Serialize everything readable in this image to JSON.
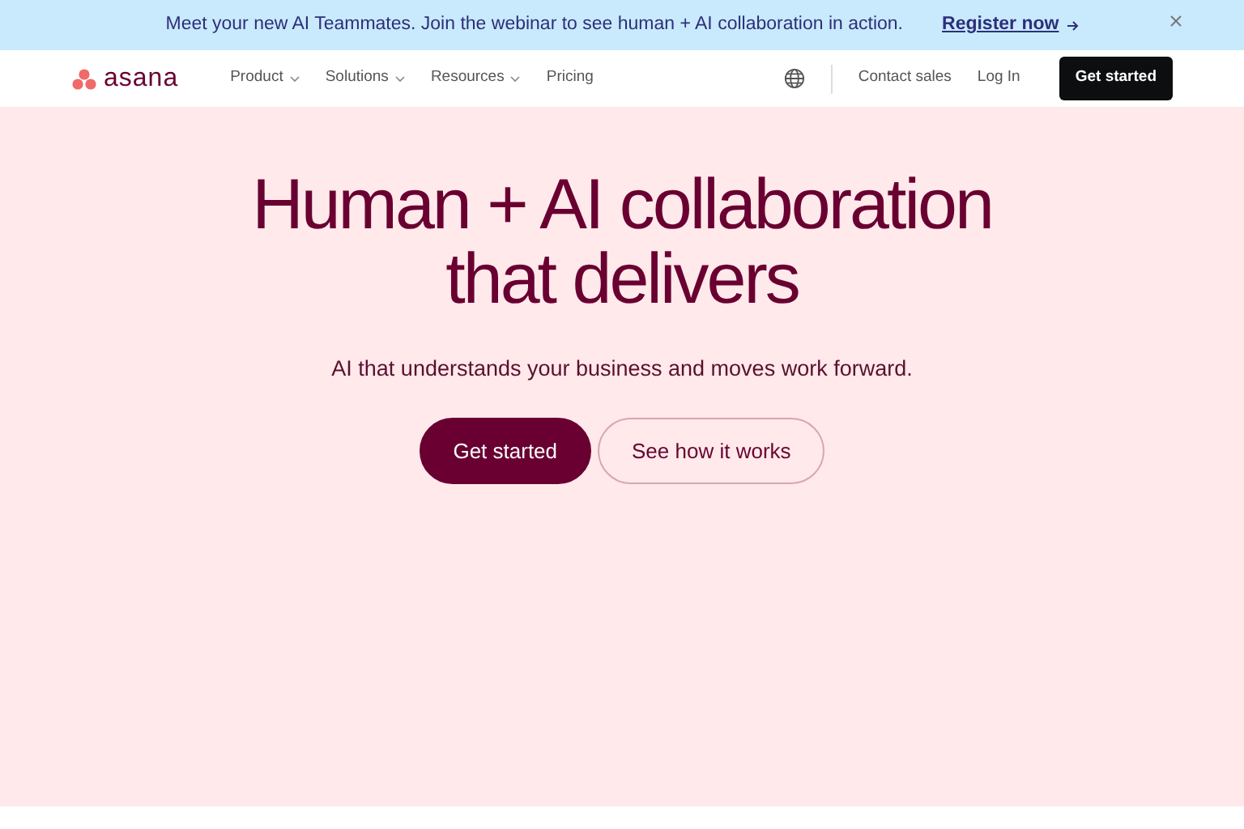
{
  "banner": {
    "message": "Meet your new AI Teammates. Join the webinar to see human + AI collaboration in action.",
    "link": "Register now"
  },
  "nav": {
    "logo": "asana",
    "items": [
      {
        "label": "Product",
        "kind": "dropdown"
      },
      {
        "label": "Solutions",
        "kind": "dropdown"
      },
      {
        "label": "Resources",
        "kind": "dropdown"
      },
      {
        "label": "Pricing",
        "kind": "link"
      }
    ],
    "contact": "Contact sales",
    "login": "Log In",
    "cta": "Get started"
  },
  "hero": {
    "title_lines": [
      "Human + AI collaboration",
      "that delivers"
    ],
    "subtitle": "AI that understands your business and moves work forward.",
    "buttons": [
      {
        "label": "Get started",
        "kind": "primary"
      },
      {
        "label": "See how it works",
        "kind": "secondary"
      }
    ]
  }
}
